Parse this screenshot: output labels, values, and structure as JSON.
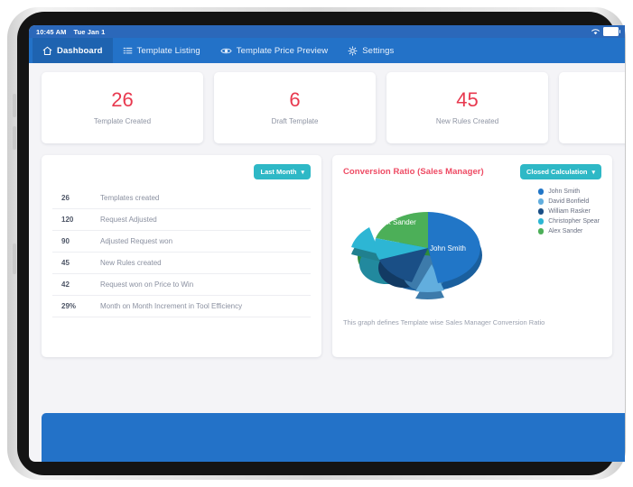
{
  "statusbar": {
    "time": "10:45 AM",
    "date": "Tue Jan 1",
    "wifi_icon": "wifi-icon",
    "battery_icon": "battery-icon"
  },
  "nav": {
    "items": [
      {
        "label": "Dashboard",
        "icon": "home-icon",
        "active": true
      },
      {
        "label": "Template Listing",
        "icon": "list-icon",
        "active": false
      },
      {
        "label": "Template Price Preview",
        "icon": "eye-icon",
        "active": false
      },
      {
        "label": "Settings",
        "icon": "gear-icon",
        "active": false
      }
    ]
  },
  "kpis": [
    {
      "value": "26",
      "label": "Template Created"
    },
    {
      "value": "6",
      "label": "Draft Template"
    },
    {
      "value": "45",
      "label": "New Rules Created"
    },
    {
      "value": "",
      "label": ""
    }
  ],
  "stats_panel": {
    "filter_label": "Last Month",
    "filter_chevron": "chevron-down-icon",
    "rows": [
      {
        "num": "26",
        "text": "Templates created"
      },
      {
        "num": "120",
        "text": "Request Adjusted"
      },
      {
        "num": "90",
        "text": "Adjusted Request won"
      },
      {
        "num": "45",
        "text": "New Rules created"
      },
      {
        "num": "42",
        "text": "Request won on Price to Win"
      },
      {
        "num": "29%",
        "text": "Month on Month Increment in Tool Efficiency"
      }
    ]
  },
  "chart_panel": {
    "title": "Conversion Ratio (Sales Manager)",
    "filter_label": "Closed Calculation",
    "filter_chevron": "chevron-down-icon",
    "caption": "This graph defines Template wise Sales Manager Conversion Ratio",
    "slice_label_1": "John Smith",
    "slice_label_2": "Alex Sander"
  },
  "chart_data": {
    "type": "pie",
    "title": "Conversion Ratio (Sales Manager)",
    "labels": [
      "John Smith",
      "David Bonfield",
      "William Rasker",
      "Christopher Spear",
      "Alex Sander"
    ],
    "values": [
      40,
      10,
      12,
      11,
      27
    ],
    "colors": [
      "#2176c7",
      "#62aede",
      "#1a4f86",
      "#2db6d4",
      "#4caf58"
    ],
    "legend_position": "right",
    "exploded": [
      "David Bonfield",
      "Christopher Spear"
    ],
    "inner_labels": [
      "John Smith",
      "Alex Sander"
    ]
  },
  "theme": {
    "nav_blue": "#2372c8",
    "nav_active_blue": "#1e63b0",
    "accent_red": "#e8394f",
    "pill_teal": "#2eb8c6",
    "page_bg": "#f4f4f7"
  }
}
